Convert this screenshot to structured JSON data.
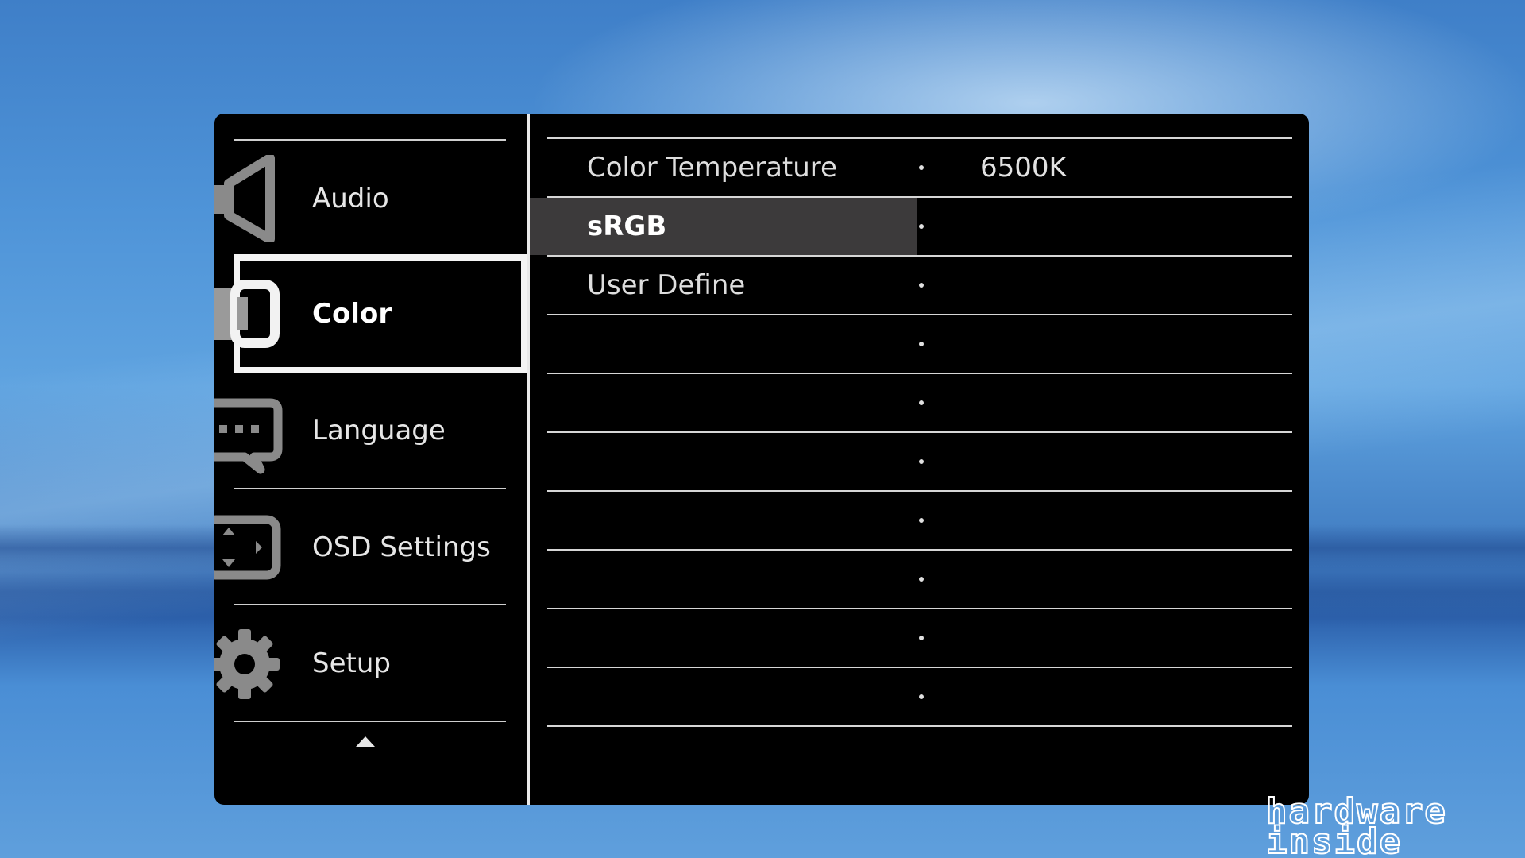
{
  "sidebar": {
    "items": [
      {
        "label": "Audio",
        "icon": "speaker-icon"
      },
      {
        "label": "Color",
        "icon": "monitor-icon",
        "selected": true
      },
      {
        "label": "Language",
        "icon": "speech-bubble-icon"
      },
      {
        "label": "OSD Settings",
        "icon": "osd-screen-icon"
      },
      {
        "label": "Setup",
        "icon": "gear-icon"
      }
    ],
    "scroll_indicator": "up-arrow-icon"
  },
  "content": {
    "rows": [
      {
        "name": "Color Temperature",
        "value": "6500K"
      },
      {
        "name": "sRGB",
        "value": "",
        "highlighted": true
      },
      {
        "name": "User Define",
        "value": ""
      },
      {
        "name": "",
        "value": ""
      },
      {
        "name": "",
        "value": ""
      },
      {
        "name": "",
        "value": ""
      },
      {
        "name": "",
        "value": ""
      },
      {
        "name": "",
        "value": ""
      },
      {
        "name": "",
        "value": ""
      },
      {
        "name": "",
        "value": ""
      }
    ]
  },
  "watermark": {
    "line1": "hardware",
    "line2": "inside"
  },
  "colors": {
    "osd_background": "#000000",
    "highlight_row": "#3c3a3b",
    "text": "#e6e6e6"
  }
}
